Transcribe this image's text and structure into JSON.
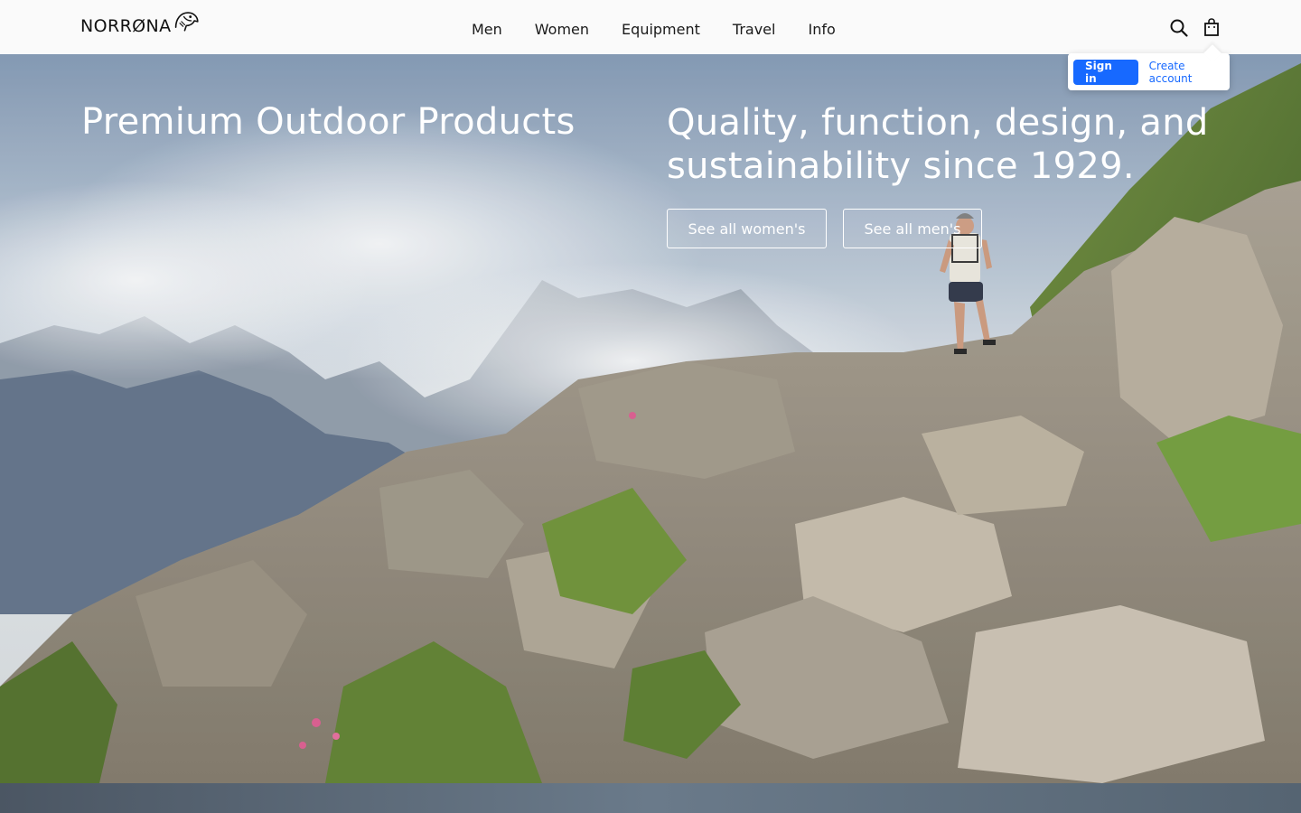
{
  "header": {
    "logo_text": "NORRØNA",
    "nav": [
      {
        "label": "Men"
      },
      {
        "label": "Women"
      },
      {
        "label": "Equipment"
      },
      {
        "label": "Travel"
      },
      {
        "label": "Info"
      }
    ],
    "icons": {
      "search": "search-icon",
      "bag": "shopping-bag-icon"
    }
  },
  "account_popover": {
    "sign_in_label": "Sign in",
    "create_account_label": "Create account"
  },
  "hero": {
    "title": "Premium Outdoor Products",
    "subtitle": "Quality, function, design, and sustainability since 1929.",
    "buttons": [
      {
        "label": "See all women's"
      },
      {
        "label": "See all men's"
      }
    ]
  },
  "colors": {
    "accent": "#1769ff",
    "header_bg": "#fafafa",
    "hero_text": "#ffffff"
  }
}
